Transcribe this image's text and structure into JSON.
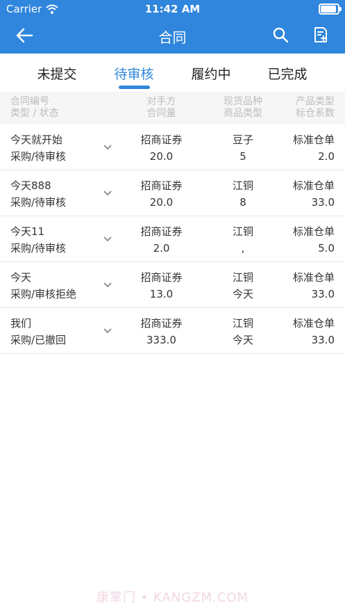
{
  "status_bar": {
    "carrier": "Carrier",
    "time": "11:42 AM"
  },
  "nav": {
    "title": "合同"
  },
  "tabs": [
    {
      "label": "未提交"
    },
    {
      "label": "待审核"
    },
    {
      "label": "履约中"
    },
    {
      "label": "已完成"
    }
  ],
  "table_header": {
    "col1_line1": "合同编号",
    "col1_line2": "类型 / 状态",
    "col2_line1": "对手方",
    "col2_line2": "合同量",
    "col3_line1": "现货品种",
    "col3_line2": "商品类型",
    "col4_line1": "产品类型",
    "col4_line2": "标仓系数"
  },
  "rows": [
    {
      "number": "今天就开始",
      "status": "采购/待审核",
      "counterparty": "招商证券",
      "quantity": "20.0",
      "variety": "豆子",
      "goods_type": "5",
      "product_type": "标准仓单",
      "coefficient": "2.0"
    },
    {
      "number": "今天888",
      "status": "采购/待审核",
      "counterparty": "招商证券",
      "quantity": "20.0",
      "variety": "江铜",
      "goods_type": "8",
      "product_type": "标准仓单",
      "coefficient": "33.0"
    },
    {
      "number": "今天11",
      "status": "采购/待审核",
      "counterparty": "招商证券",
      "quantity": "2.0",
      "variety": "江铜",
      "goods_type": ",",
      "product_type": "标准仓单",
      "coefficient": "5.0"
    },
    {
      "number": "今天",
      "status": "采购/审核拒绝",
      "counterparty": "招商证券",
      "quantity": "13.0",
      "variety": "江铜",
      "goods_type": "今天",
      "product_type": "标准仓单",
      "coefficient": "33.0"
    },
    {
      "number": "我们",
      "status": "采购/已撤回",
      "counterparty": "招商证券",
      "quantity": "333.0",
      "variety": "江铜",
      "goods_type": "今天",
      "product_type": "标准仓单",
      "coefficient": "33.0"
    }
  ],
  "watermark": "康掌门 • KANGZM.COM",
  "colors": {
    "primary": "#2f86dc",
    "header_bg": "#f6f6f6",
    "muted_text": "#bcbcbc"
  }
}
